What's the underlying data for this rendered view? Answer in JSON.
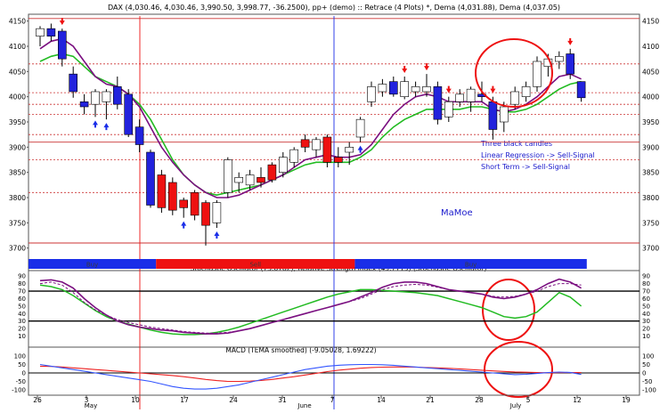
{
  "title": "DAX (4,030.46, 4,030.46, 3,990.50, 3,998.77, -36.2500), pp+ (demo) :: Retrace (4 Plots) *, Dema (4,031.88), Dema (4,037.05)",
  "watermark": "MaMoe",
  "annotation": [
    "Three black candles",
    "Linear Regression -> Sell-Signal",
    "Short Term -> Sell-Signal"
  ],
  "colors": {
    "up_white": "#ffffff",
    "down_blue": "#2222dd",
    "down_red": "#ee1111",
    "dema_fast": "#7a0f80",
    "dema_slow": "#22bb22",
    "stoch_k": "#7a0f80",
    "rsi": "#22bb22",
    "macd": "#3355ff",
    "macd_signal": "#ee2222",
    "annotation_text": "#1a1acc",
    "circle": "#ee1111",
    "band_blue": "#1a2ee8",
    "band_red": "#ee1111",
    "grid": "#cc3333"
  },
  "chart_data": [
    {
      "type": "candlestick",
      "title": "DAX (4,030.46, 4,030.46, 3,990.50, 3,998.77, -36.2500), pp+ (demo) :: Retrace (4 Plots) *, Dema (4,031.88), Dema (4,037.05)",
      "ylim": [
        3680,
        4160
      ],
      "yticks": [
        3700,
        3750,
        3800,
        3850,
        3900,
        3950,
        4000,
        4050,
        4100,
        4150
      ],
      "xticks": [
        "26",
        "3",
        "10",
        "17",
        "24",
        "31",
        "7",
        "14",
        "21",
        "28",
        "5",
        "12",
        "19"
      ],
      "months": [
        "May",
        "June",
        "July"
      ],
      "hlines_solid": [
        4155,
        3910,
        3710
      ],
      "hlines_dashed": [
        4065,
        4008,
        3985,
        3965,
        3925,
        3875,
        3810
      ],
      "candles": [
        {
          "o": 4120,
          "h": 4140,
          "l": 4100,
          "c": 4135,
          "color": "up"
        },
        {
          "o": 4135,
          "h": 4145,
          "l": 4110,
          "c": 4120,
          "color": "blue"
        },
        {
          "o": 4130,
          "h": 4135,
          "l": 4060,
          "c": 4075,
          "color": "blue"
        },
        {
          "o": 4045,
          "h": 4060,
          "l": 3998,
          "c": 4010,
          "color": "blue"
        },
        {
          "o": 3990,
          "h": 4005,
          "l": 3965,
          "c": 3980,
          "color": "blue"
        },
        {
          "o": 3985,
          "h": 4015,
          "l": 3960,
          "c": 4010,
          "color": "up"
        },
        {
          "o": 3990,
          "h": 4015,
          "l": 3955,
          "c": 4010,
          "color": "up"
        },
        {
          "o": 4020,
          "h": 4040,
          "l": 3975,
          "c": 3985,
          "color": "blue"
        },
        {
          "o": 4005,
          "h": 4015,
          "l": 3920,
          "c": 3925,
          "color": "blue"
        },
        {
          "o": 3940,
          "h": 3955,
          "l": 3890,
          "c": 3905,
          "color": "blue"
        },
        {
          "o": 3890,
          "h": 3895,
          "l": 3780,
          "c": 3785,
          "color": "blue"
        },
        {
          "o": 3845,
          "h": 3855,
          "l": 3770,
          "c": 3780,
          "color": "red"
        },
        {
          "o": 3830,
          "h": 3840,
          "l": 3765,
          "c": 3775,
          "color": "red"
        },
        {
          "o": 3795,
          "h": 3800,
          "l": 3760,
          "c": 3780,
          "color": "red"
        },
        {
          "o": 3810,
          "h": 3815,
          "l": 3755,
          "c": 3765,
          "color": "red"
        },
        {
          "o": 3790,
          "h": 3795,
          "l": 3705,
          "c": 3745,
          "color": "red"
        },
        {
          "o": 3750,
          "h": 3795,
          "l": 3740,
          "c": 3790,
          "color": "up"
        },
        {
          "o": 3810,
          "h": 3880,
          "l": 3800,
          "c": 3875,
          "color": "up"
        },
        {
          "o": 3830,
          "h": 3850,
          "l": 3810,
          "c": 3840,
          "color": "up"
        },
        {
          "o": 3825,
          "h": 3855,
          "l": 3815,
          "c": 3845,
          "color": "up"
        },
        {
          "o": 3840,
          "h": 3860,
          "l": 3820,
          "c": 3830,
          "color": "red"
        },
        {
          "o": 3835,
          "h": 3870,
          "l": 3830,
          "c": 3865,
          "color": "red"
        },
        {
          "o": 3850,
          "h": 3890,
          "l": 3840,
          "c": 3880,
          "color": "up"
        },
        {
          "o": 3870,
          "h": 3900,
          "l": 3860,
          "c": 3895,
          "color": "up"
        },
        {
          "o": 3900,
          "h": 3925,
          "l": 3890,
          "c": 3915,
          "color": "red"
        },
        {
          "o": 3915,
          "h": 3920,
          "l": 3880,
          "c": 3895,
          "color": "up"
        },
        {
          "o": 3920,
          "h": 3925,
          "l": 3860,
          "c": 3870,
          "color": "red"
        },
        {
          "o": 3880,
          "h": 3900,
          "l": 3860,
          "c": 3870,
          "color": "red"
        },
        {
          "o": 3890,
          "h": 3910,
          "l": 3865,
          "c": 3900,
          "color": "up"
        },
        {
          "o": 3920,
          "h": 3960,
          "l": 3910,
          "c": 3955,
          "color": "up"
        },
        {
          "o": 3990,
          "h": 4030,
          "l": 3980,
          "c": 4020,
          "color": "up"
        },
        {
          "o": 4010,
          "h": 4035,
          "l": 4000,
          "c": 4025,
          "color": "up"
        },
        {
          "o": 4030,
          "h": 4040,
          "l": 4000,
          "c": 4005,
          "color": "blue"
        },
        {
          "o": 4000,
          "h": 4040,
          "l": 3995,
          "c": 4030,
          "color": "up"
        },
        {
          "o": 4020,
          "h": 4030,
          "l": 4000,
          "c": 4010,
          "color": "up"
        },
        {
          "o": 4010,
          "h": 4045,
          "l": 4000,
          "c": 4020,
          "color": "up"
        },
        {
          "o": 4020,
          "h": 4030,
          "l": 3945,
          "c": 3955,
          "color": "blue"
        },
        {
          "o": 3960,
          "h": 4000,
          "l": 3950,
          "c": 3990,
          "color": "up"
        },
        {
          "o": 3990,
          "h": 4015,
          "l": 3980,
          "c": 4005,
          "color": "up"
        },
        {
          "o": 4015,
          "h": 4020,
          "l": 3970,
          "c": 3990,
          "color": "up"
        },
        {
          "o": 4005,
          "h": 4030,
          "l": 3990,
          "c": 4000,
          "color": "blue"
        },
        {
          "o": 3990,
          "h": 4000,
          "l": 3915,
          "c": 3935,
          "color": "blue"
        },
        {
          "o": 3950,
          "h": 3990,
          "l": 3930,
          "c": 3980,
          "color": "up"
        },
        {
          "o": 3985,
          "h": 4020,
          "l": 3975,
          "c": 4010,
          "color": "up"
        },
        {
          "o": 4000,
          "h": 4030,
          "l": 3990,
          "c": 4020,
          "color": "up"
        },
        {
          "o": 4020,
          "h": 4080,
          "l": 4010,
          "c": 4070,
          "color": "up"
        },
        {
          "o": 4060,
          "h": 4085,
          "l": 4040,
          "c": 4075,
          "color": "up"
        },
        {
          "o": 4070,
          "h": 4090,
          "l": 4055,
          "c": 4080,
          "color": "up"
        },
        {
          "o": 4085,
          "h": 4095,
          "l": 4035,
          "c": 4045,
          "color": "blue"
        },
        {
          "o": 4030,
          "h": 4030,
          "l": 3990,
          "c": 3998,
          "color": "blue"
        }
      ],
      "series": [
        {
          "values": [
            4095,
            4110,
            4115,
            4100,
            4070,
            4040,
            4025,
            4020,
            4005,
            3980,
            3940,
            3900,
            3870,
            3845,
            3825,
            3810,
            3800,
            3800,
            3805,
            3815,
            3825,
            3835,
            3845,
            3860,
            3875,
            3880,
            3885,
            3880,
            3880,
            3885,
            3905,
            3935,
            3965,
            3985,
            4000,
            4005,
            4000,
            3990,
            3990,
            3990,
            3990,
            3975,
            3970,
            3975,
            3985,
            4000,
            4020,
            4040,
            4045,
            4035
          ]
        },
        {
          "values": [
            4070,
            4080,
            4085,
            4080,
            4060,
            4040,
            4030,
            4020,
            4005,
            3985,
            3955,
            3915,
            3875,
            3845,
            3825,
            3810,
            3805,
            3810,
            3815,
            3820,
            3825,
            3835,
            3845,
            3855,
            3865,
            3870,
            3870,
            3870,
            3870,
            3880,
            3895,
            3920,
            3940,
            3955,
            3965,
            3975,
            3975,
            3975,
            3975,
            3980,
            3980,
            3975,
            3970,
            3970,
            3975,
            3985,
            4000,
            4015,
            4025,
            4030
          ]
        }
      ],
      "markers_down": [
        2,
        33,
        35,
        37,
        41,
        48
      ],
      "markers_up": [
        5,
        6,
        13,
        16,
        29
      ],
      "bands": [
        {
          "label": "Buy",
          "from": 0,
          "to": 11,
          "color": "blue"
        },
        {
          "label": "Sell",
          "from": 11,
          "to": 29,
          "color": "red"
        },
        {
          "label": "Buy",
          "from": 29,
          "to": 50,
          "color": "blue"
        }
      ]
    },
    {
      "type": "line",
      "title": "Stochastic Oscillator (73.6782), Relative Strength Index (49.7719) (Stochastic Oscillator)",
      "ylim": [
        0,
        95
      ],
      "yticks": [
        10,
        20,
        30,
        40,
        50,
        60,
        70,
        80,
        90
      ],
      "hlines": [
        70,
        30
      ],
      "series": [
        {
          "values": [
            84,
            85,
            82,
            74,
            60,
            48,
            38,
            30,
            25,
            22,
            20,
            18,
            17,
            15,
            14,
            13,
            13,
            14,
            17,
            20,
            24,
            28,
            32,
            36,
            40,
            44,
            48,
            52,
            56,
            62,
            68,
            75,
            80,
            82,
            82,
            80,
            76,
            72,
            70,
            68,
            66,
            62,
            60,
            62,
            66,
            72,
            80,
            86,
            82,
            74
          ]
        },
        {
          "values": [
            80,
            82,
            78,
            68,
            55,
            45,
            38,
            32,
            28,
            25,
            22,
            20,
            18,
            16,
            15,
            14,
            14,
            15,
            17,
            20,
            24,
            28,
            32,
            36,
            40,
            44,
            48,
            52,
            56,
            60,
            66,
            72,
            76,
            78,
            79,
            78,
            75,
            72,
            70,
            68,
            66,
            63,
            62,
            63,
            66,
            70,
            76,
            80,
            80,
            78
          ]
        },
        {
          "values": [
            78,
            76,
            72,
            64,
            54,
            44,
            36,
            30,
            26,
            22,
            18,
            15,
            13,
            12,
            12,
            13,
            15,
            18,
            22,
            27,
            32,
            37,
            42,
            47,
            52,
            57,
            62,
            66,
            69,
            72,
            72,
            71,
            70,
            69,
            68,
            66,
            64,
            60,
            56,
            52,
            48,
            42,
            36,
            34,
            36,
            42,
            55,
            68,
            62,
            50
          ]
        }
      ]
    },
    {
      "type": "line",
      "title": "MACD (TEMA smoothed) (-9.05028, 1.69222)",
      "ylim": [
        -110,
        110
      ],
      "yticks": [
        -100,
        -50,
        0,
        50,
        100
      ],
      "hlines": [
        0
      ],
      "series": [
        {
          "values": [
            50,
            40,
            30,
            20,
            10,
            0,
            -10,
            -20,
            -30,
            -40,
            -50,
            -65,
            -80,
            -90,
            -95,
            -95,
            -90,
            -80,
            -70,
            -55,
            -40,
            -25,
            -10,
            5,
            20,
            30,
            40,
            45,
            48,
            50,
            50,
            48,
            45,
            40,
            35,
            30,
            25,
            20,
            15,
            10,
            5,
            0,
            -5,
            -10,
            -8,
            -3,
            2,
            5,
            3,
            -9
          ]
        },
        {
          "values": [
            40,
            38,
            35,
            30,
            25,
            20,
            15,
            10,
            5,
            0,
            -5,
            -10,
            -15,
            -22,
            -30,
            -38,
            -45,
            -50,
            -50,
            -48,
            -44,
            -38,
            -30,
            -22,
            -12,
            -2,
            8,
            16,
            22,
            28,
            32,
            34,
            35,
            35,
            34,
            32,
            30,
            27,
            24,
            20,
            16,
            12,
            9,
            6,
            4,
            2,
            1,
            2,
            2,
            2
          ]
        }
      ]
    }
  ]
}
